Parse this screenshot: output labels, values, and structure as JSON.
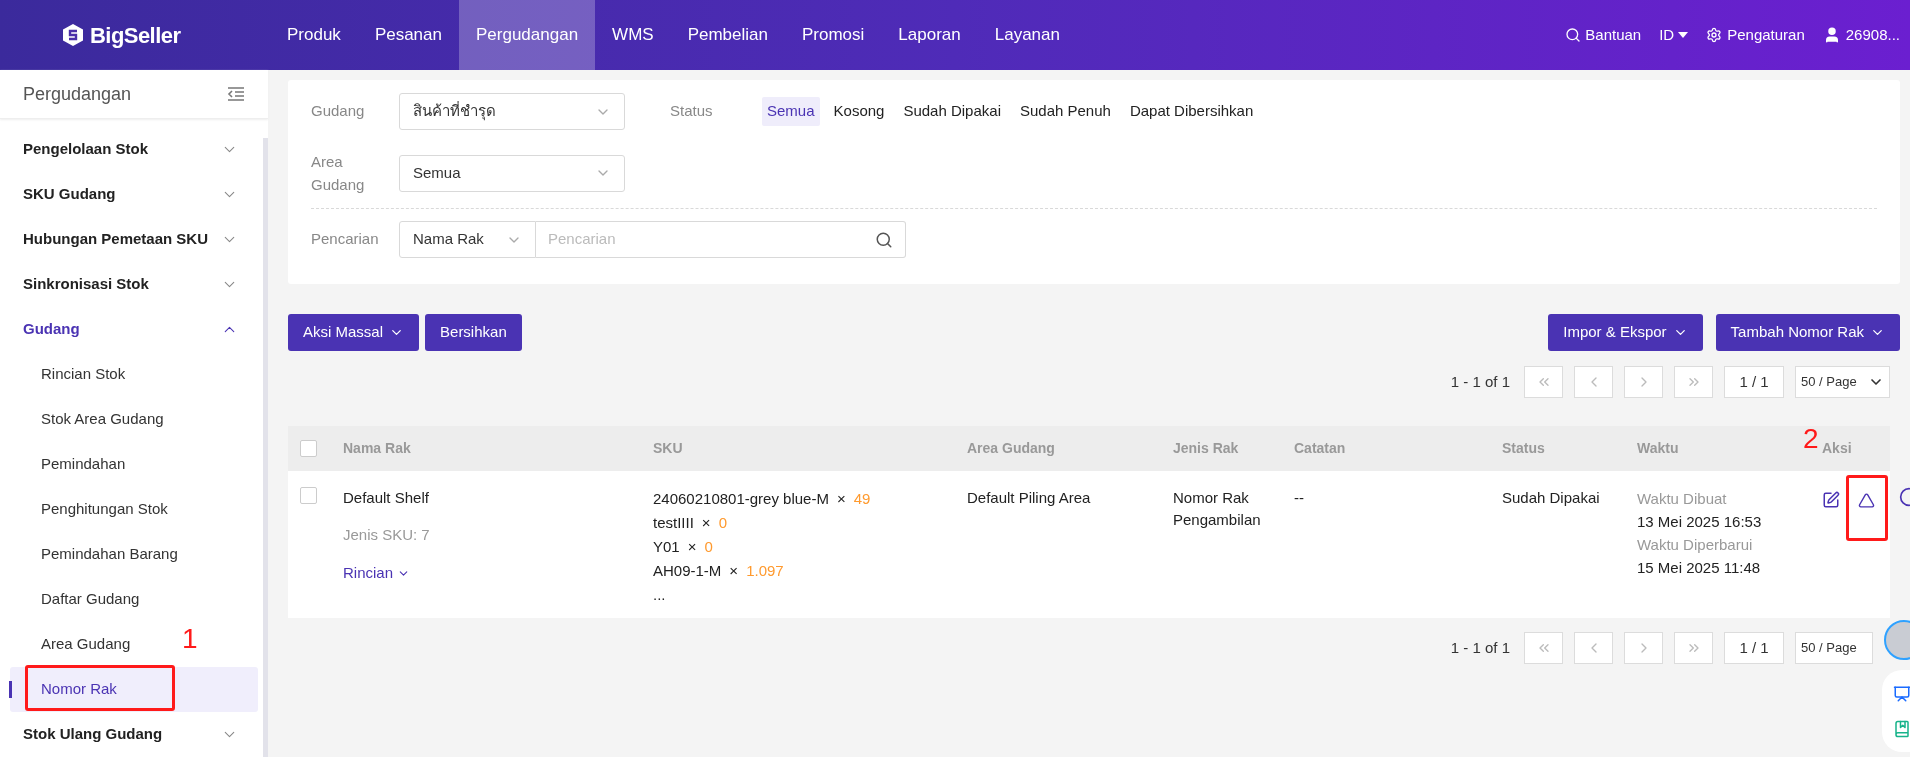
{
  "brand": {
    "name": "BigSeller"
  },
  "nav": [
    {
      "label": "Produk",
      "selected": false
    },
    {
      "label": "Pesanan",
      "selected": false
    },
    {
      "label": "Pergudangan",
      "selected": true
    },
    {
      "label": "WMS",
      "selected": false
    },
    {
      "label": "Pembelian",
      "selected": false
    },
    {
      "label": "Promosi",
      "selected": false
    },
    {
      "label": "Laporan",
      "selected": false
    },
    {
      "label": "Layanan",
      "selected": false
    }
  ],
  "header_right": {
    "help": "Bantuan",
    "language": "ID",
    "settings": "Pengaturan",
    "user": "26908..."
  },
  "sidebar": {
    "title": "Pergudangan",
    "items": [
      {
        "label": "Pengelolaan Stok",
        "expanded": false
      },
      {
        "label": "SKU Gudang",
        "expanded": false
      },
      {
        "label": "Hubungan Pemetaan SKU",
        "expanded": false
      },
      {
        "label": "Sinkronisasi Stok",
        "expanded": false
      },
      {
        "label": "Gudang",
        "expanded": true,
        "children": [
          {
            "label": "Rincian Stok",
            "selected": false
          },
          {
            "label": "Stok Area Gudang",
            "selected": false
          },
          {
            "label": "Pemindahan",
            "selected": false
          },
          {
            "label": "Penghitungan Stok",
            "selected": false
          },
          {
            "label": "Pemindahan Barang",
            "selected": false
          },
          {
            "label": "Daftar Gudang",
            "selected": false
          },
          {
            "label": "Area Gudang",
            "selected": false
          },
          {
            "label": "Nomor Rak",
            "selected": true,
            "annotation": "1"
          }
        ]
      },
      {
        "label": "Stok Ulang Gudang",
        "expanded": false
      }
    ]
  },
  "filters": {
    "warehouse": {
      "label": "Gudang",
      "value": "สินค้าที่ชำรุด"
    },
    "status": {
      "label": "Status",
      "options": [
        {
          "label": "Semua",
          "selected": true
        },
        {
          "label": "Kosong",
          "selected": false
        },
        {
          "label": "Sudah Dipakai",
          "selected": false
        },
        {
          "label": "Sudah Penuh",
          "selected": false
        },
        {
          "label": "Dapat Dibersihkan",
          "selected": false
        }
      ]
    },
    "area": {
      "label": "Area Gudang",
      "value": "Semua"
    },
    "search": {
      "label": "Pencarian",
      "field": "Nama Rak",
      "placeholder": "Pencarian"
    }
  },
  "toolbar": {
    "left": [
      {
        "label": "Aksi Massal",
        "dropdown": true
      },
      {
        "label": "Bersihkan",
        "dropdown": false
      }
    ],
    "right": [
      {
        "label": "Impor & Ekspor",
        "dropdown": true
      },
      {
        "label": "Tambah Nomor Rak",
        "dropdown": true
      }
    ]
  },
  "pagination_top": {
    "summary": "1 - 1 of 1",
    "page": "1 / 1",
    "page_size": "50 / Page"
  },
  "table": {
    "select_all": {
      "checked": false
    },
    "columns": [
      "Nama Rak",
      "SKU",
      "Area Gudang",
      "Jenis Rak",
      "Catatan",
      "Status",
      "Waktu",
      "Aksi"
    ],
    "rows": [
      {
        "checked": false,
        "name": "Default Shelf",
        "sku_types": "Jenis SKU: 7",
        "details_link": "Rincian",
        "skus": [
          {
            "code": "24060210801-grey blue-M",
            "sep": "×",
            "qty": "49"
          },
          {
            "code": "testIIII",
            "sep": "×",
            "qty": "0"
          },
          {
            "code": "Y01",
            "sep": "×",
            "qty": "0"
          },
          {
            "code": "AH09-1-M",
            "sep": "×",
            "qty": "1.097"
          }
        ],
        "more": "...",
        "area": "Default Piling Area",
        "type": "Nomor Rak Pengambilan",
        "note": "--",
        "status": "Sudah Dipakai",
        "created_label": "Waktu Dibuat",
        "created": "13 Mei 2025 16:53",
        "updated_label": "Waktu Diperbarui",
        "updated": "15 Mei 2025 11:48",
        "actions": [
          {
            "kind": "edit"
          },
          {
            "kind": "recycle",
            "annotation": "2"
          }
        ]
      }
    ]
  },
  "pagination_bottom": {
    "summary": "1 - 1 of 1",
    "page": "1 / 1",
    "page_size": "50 / Page"
  }
}
